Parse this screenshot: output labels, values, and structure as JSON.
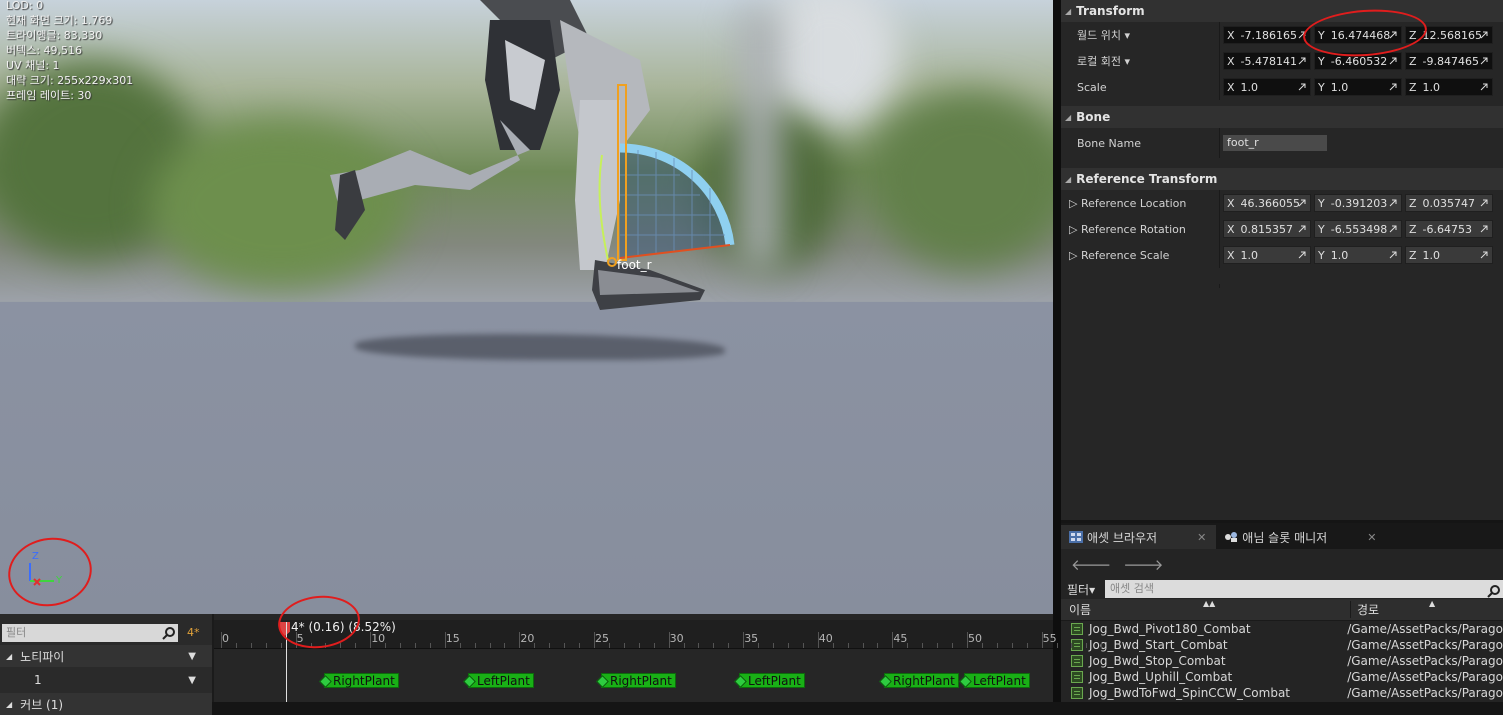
{
  "viewport": {
    "stats": [
      "LOD: 0",
      "현재 화면 크기: 1.769",
      "트라이앵글: 83,330",
      "버텍스: 49,516",
      "UV 채널: 1",
      "대략 크기: 255x229x301",
      "프레임 레이트: 30"
    ],
    "bone_label": "foot_r",
    "axis": {
      "z": "Z",
      "y": "Y"
    }
  },
  "details": {
    "transform": {
      "title": "Transform",
      "rows": [
        {
          "label": "월드 위치",
          "x": "-7.186165",
          "y": "16.474468",
          "z": "12.568165"
        },
        {
          "label": "로컬 회전",
          "x": "-5.478141",
          "y": "-6.460532",
          "z": "-9.847465"
        },
        {
          "label": "Scale",
          "x": "1.0",
          "y": "1.0",
          "z": "1.0"
        }
      ]
    },
    "bone": {
      "title": "Bone",
      "name_label": "Bone Name",
      "name_value": "foot_r"
    },
    "reference": {
      "title": "Reference Transform",
      "rows": [
        {
          "label": "Reference Location",
          "x": "46.366055",
          "y": "-0.391203",
          "z": "0.035747"
        },
        {
          "label": "Reference Rotation",
          "x": "0.815357",
          "y": "-6.553498",
          "z": "-6.64753"
        },
        {
          "label": "Reference Scale",
          "x": "1.0",
          "y": "1.0",
          "z": "1.0"
        }
      ]
    }
  },
  "assets": {
    "tab1": "애셋 브라우저",
    "tab2": "애님 슬롯 매니저",
    "close": "✕",
    "filter_label": "필터",
    "search_placeholder": "애셋 검색",
    "col_name": "이름",
    "col_path": "경로",
    "rows": [
      {
        "name": "Jog_Bwd_Pivot180_Combat",
        "path": "/Game/AssetPacks/Parago"
      },
      {
        "name": "Jog_Bwd_Start_Combat",
        "path": "/Game/AssetPacks/Parago"
      },
      {
        "name": "Jog_Bwd_Stop_Combat",
        "path": "/Game/AssetPacks/Parago"
      },
      {
        "name": "Jog_Bwd_Uphill_Combat",
        "path": "/Game/AssetPacks/Parago"
      },
      {
        "name": "Jog_BwdToFwd_SpinCCW_Combat",
        "path": "/Game/AssetPacks/Parago"
      }
    ]
  },
  "timeline": {
    "filter_placeholder": "필터",
    "frame": "4*",
    "track_notify": "노티파이",
    "track_1": "1",
    "track_cut": "커브 (1)",
    "playhead_label": "4* (0.16) (8.52%)",
    "ticks": [
      "0",
      "5",
      "10",
      "15",
      "20",
      "25",
      "30",
      "35",
      "40",
      "45",
      "50",
      "55"
    ],
    "notifies": [
      "RightPlant",
      "LeftPlant",
      "RightPlant",
      "LeftPlant",
      "RightPlant",
      "LeftPlant"
    ]
  },
  "colors": {
    "accent": "#e1a13a",
    "notify": "#19b016",
    "annotation": "#e01d1d"
  }
}
